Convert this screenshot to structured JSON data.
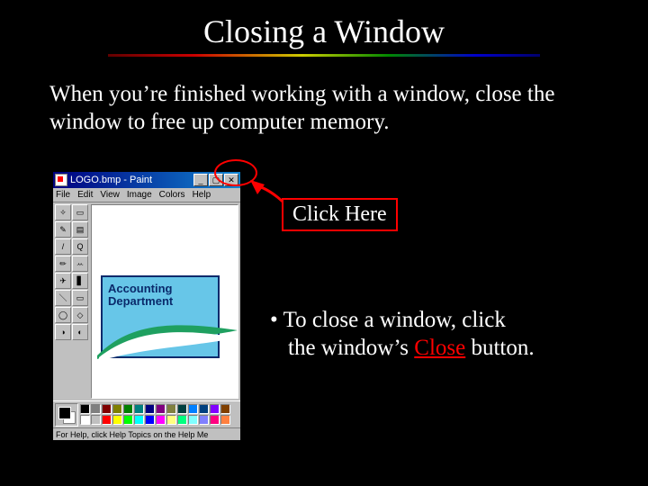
{
  "title": "Closing a Window",
  "intro": "When you’re finished working with a window, close the window to free up computer memory.",
  "paint": {
    "title": "LOGO.bmp - Paint",
    "menus": [
      "File",
      "Edit",
      "View",
      "Image",
      "Colors",
      "Help"
    ],
    "winbtns": {
      "min": "_",
      "max": "▢",
      "close": "✕"
    },
    "tools_glyphs": [
      "✧",
      "▭",
      "✎",
      "▤",
      "/",
      "Q",
      "✏",
      "ꕀ",
      "✈",
      "▋",
      "＼",
      "▭",
      "◯",
      "◇",
      "◑",
      "◐"
    ],
    "logo_line1": "Accounting",
    "logo_line2": "Department",
    "status": "For Help, click Help Topics on the Help Me",
    "swatches_row1": [
      "#000000",
      "#808080",
      "#800000",
      "#808000",
      "#008000",
      "#008080",
      "#000080",
      "#800080",
      "#808040",
      "#004040",
      "#0080ff",
      "#004080",
      "#8000ff",
      "#804000"
    ],
    "swatches_row2": [
      "#ffffff",
      "#c0c0c0",
      "#ff0000",
      "#ffff00",
      "#00ff00",
      "#00ffff",
      "#0000ff",
      "#ff00ff",
      "#ffff80",
      "#00ff80",
      "#80ffff",
      "#8080ff",
      "#ff0080",
      "#ff8040"
    ]
  },
  "callout": {
    "click_here": "Click Here"
  },
  "bullet": {
    "prefix": "• ",
    "part1": "To close a window, click",
    "part2_leading": "the window’s ",
    "close_word": "Close",
    "part2_trailing": " button."
  }
}
